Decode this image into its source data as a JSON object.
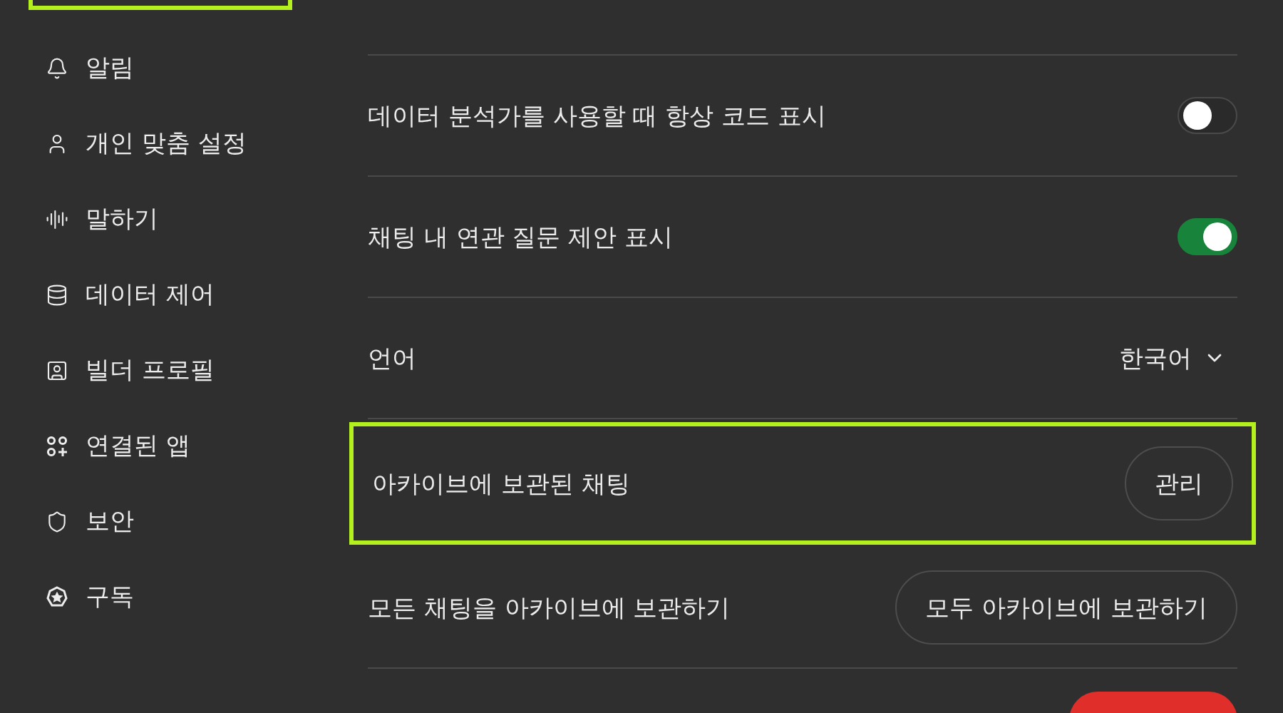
{
  "sidebar": {
    "cut_item_highlighted": true,
    "items": [
      {
        "label": "알림"
      },
      {
        "label": "개인 맞춤 설정"
      },
      {
        "label": "말하기"
      },
      {
        "label": "데이터 제어"
      },
      {
        "label": "빌더 프로필"
      },
      {
        "label": "연결된 앱"
      },
      {
        "label": "보안"
      },
      {
        "label": "구독"
      }
    ]
  },
  "settings": [
    {
      "kind": "toggle",
      "label": "데이터 분석가를 사용할 때 항상 코드 표시",
      "on": false,
      "highlighted": false
    },
    {
      "kind": "toggle",
      "label": "채팅 내 연관 질문 제안 표시",
      "on": true,
      "highlighted": false
    },
    {
      "kind": "select",
      "label": "언어",
      "value": "한국어",
      "highlighted": false
    },
    {
      "kind": "button",
      "label": "아카이브에 보관된 채팅",
      "button": "관리",
      "highlighted": true
    },
    {
      "kind": "button",
      "label": "모든 채팅을 아카이브에 보관하기",
      "button": "모두 아카이브에 보관하기",
      "highlighted": false
    },
    {
      "kind": "danger_cut"
    }
  ]
}
